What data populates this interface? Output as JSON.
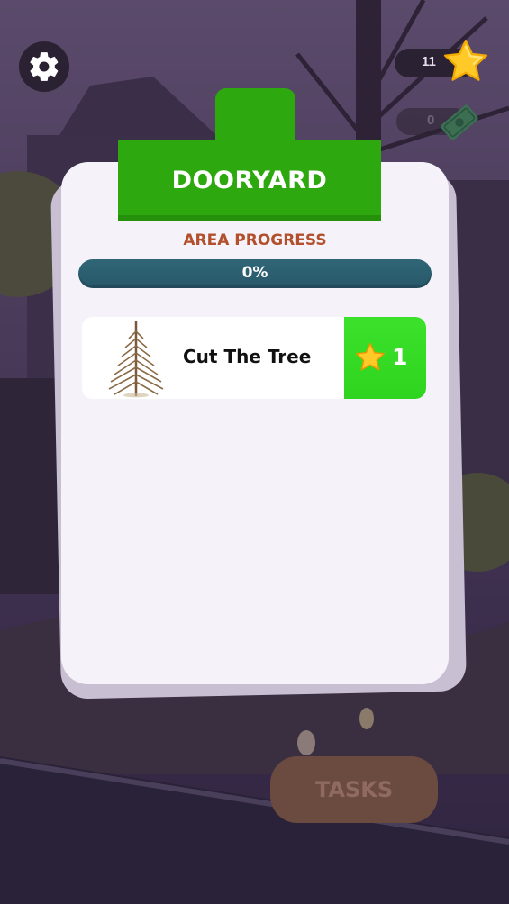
{
  "hud": {
    "settings_icon": "gear-icon",
    "star_count": "11",
    "cash_count": "0"
  },
  "panel": {
    "title": "DOORYARD",
    "area_progress_label": "AREA PROGRESS",
    "progress_value": 0,
    "progress_text": "0%",
    "tasks": [
      {
        "label": "Cut The Tree",
        "icon": "dead-tree-icon",
        "reward": "1",
        "reward_icon": "star-icon"
      }
    ]
  },
  "footer": {
    "tasks_button_label": "TASKS"
  },
  "colors": {
    "banner_green": "#2ea80f",
    "reward_green": "#2fd41f",
    "progress_track": "#2f6676",
    "area_label": "#b24f2c",
    "tasks_button": "#6b4a40"
  }
}
